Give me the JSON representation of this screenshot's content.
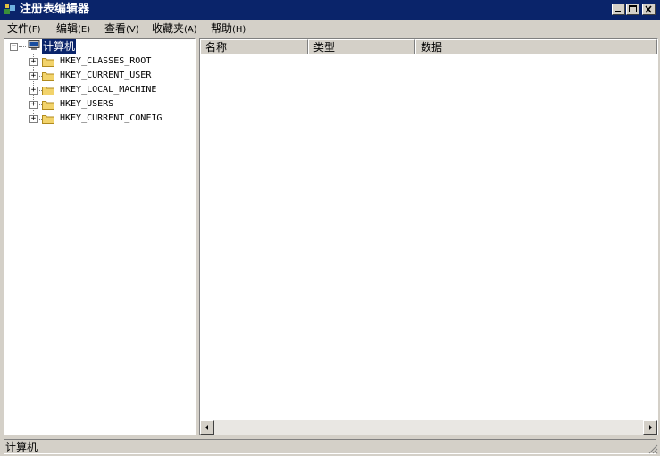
{
  "window": {
    "title": "注册表编辑器"
  },
  "menu": [
    {
      "label": "文件",
      "accel": "(F)"
    },
    {
      "label": "编辑",
      "accel": "(E)"
    },
    {
      "label": "查看",
      "accel": "(V)"
    },
    {
      "label": "收藏夹",
      "accel": "(A)"
    },
    {
      "label": "帮助",
      "accel": "(H)"
    }
  ],
  "tree": {
    "root": {
      "label": "计算机",
      "icon": "computer-icon",
      "expanded": true,
      "selected": true
    },
    "children": [
      {
        "label": "HKEY_CLASSES_ROOT",
        "icon": "folder-icon"
      },
      {
        "label": "HKEY_CURRENT_USER",
        "icon": "folder-icon"
      },
      {
        "label": "HKEY_LOCAL_MACHINE",
        "icon": "folder-icon"
      },
      {
        "label": "HKEY_USERS",
        "icon": "folder-icon"
      },
      {
        "label": "HKEY_CURRENT_CONFIG",
        "icon": "folder-icon"
      }
    ]
  },
  "list": {
    "columns": [
      "名称",
      "类型",
      "数据"
    ]
  },
  "status": {
    "text": "计算机"
  },
  "colors": {
    "titlebar": "#0a246a",
    "face": "#d4d0c8",
    "selection": "#0a246a"
  }
}
